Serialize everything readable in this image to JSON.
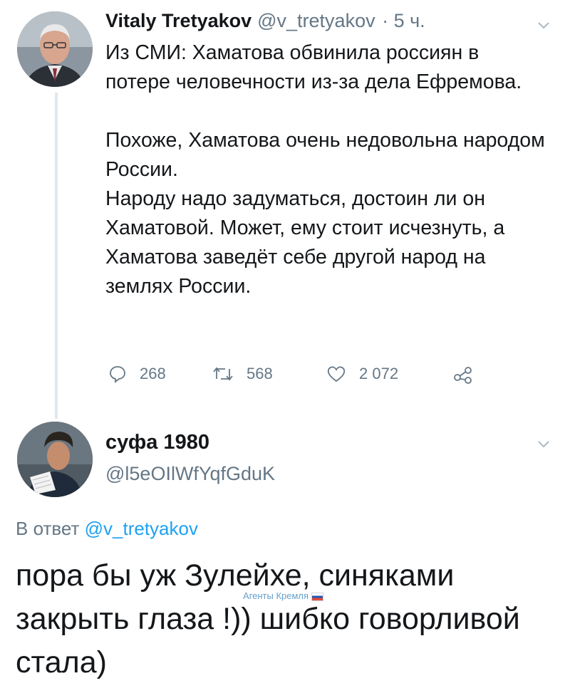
{
  "tweet": {
    "author_name": "Vitaly Tretyakov",
    "author_handle": "@v_tretyakov",
    "time": "· 5 ч.",
    "paragraph1": "Из СМИ: Хаматова обвинила россиян в потере человечности из-за дела Ефремова.",
    "paragraph2_line1": "Похоже, Хаматова очень недовольна народом России.",
    "paragraph2_line2": "Народу надо задуматься, достоин ли он Хаматовой. Может, ему стоит исчезнуть, а Хаматова заведёт себе другой народ на землях России.",
    "replies": "268",
    "retweets": "568",
    "likes": "2 072",
    "icons": [
      "reply-icon",
      "retweet-icon",
      "like-icon",
      "share-icon",
      "chevron-down-icon"
    ]
  },
  "reply": {
    "author_name": "суфа 1980",
    "author_handle": "@l5eOIlWfYqfGduK",
    "reply_to_label": "В ответ",
    "reply_to_handle": "@v_tretyakov",
    "text": "пора бы уж Зулейхе, синяками закрыть глаза !)) шибко говорливой стала)"
  },
  "watermark": "Агенты Кремля",
  "colors": {
    "text": "#14171a",
    "secondary": "#657786",
    "link": "#1da1f2",
    "thread": "#e1e8ed"
  }
}
